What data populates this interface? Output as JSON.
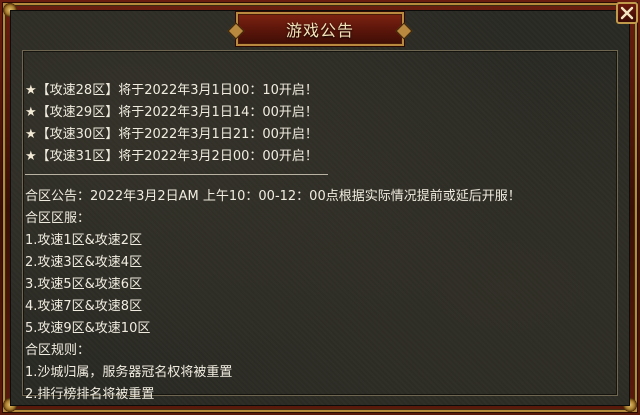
{
  "dialog": {
    "title": "游戏公告",
    "close_label": "close"
  },
  "announcements": [
    {
      "star": "★",
      "text": "【攻速28区】将于2022年3月1日00：10开启！"
    },
    {
      "star": "★",
      "text": "【攻速29区】将于2022年3月1日14：00开启！"
    },
    {
      "star": "★",
      "text": "【攻速30区】将于2022年3月1日21：00开启！"
    },
    {
      "star": "★",
      "text": "【攻速31区】将于2022年3月2日00：00开启！"
    }
  ],
  "merge": {
    "notice": "合区公告：2022年3月2日AM 上午10：00-12：00点根据实际情况提前或延后开服！",
    "servers_heading": "合区区服：",
    "servers": [
      "1.攻速1区&攻速2区",
      "2.攻速3区&攻速4区",
      "3.攻速5区&攻速6区",
      "4.攻速7区&攻速8区",
      "5.攻速9区&攻速10区"
    ],
    "rules_heading": "合区规则：",
    "rules": [
      "1.沙城归属，服务器冠名权将被重置",
      "2.排行榜排名将被重置"
    ]
  },
  "colors": {
    "frame_red": "#6b1e0f",
    "gold": "#b48a3c",
    "panel_bg": "#2a2a24",
    "text": "#f0ece0"
  }
}
